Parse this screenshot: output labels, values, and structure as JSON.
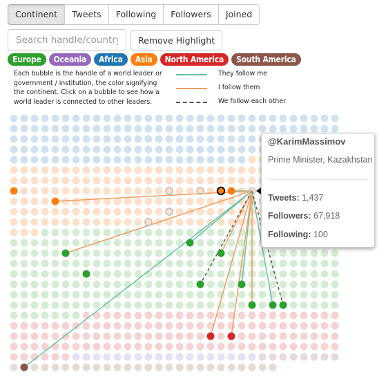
{
  "toolbar": {
    "sort_buttons": [
      {
        "label": "Continent",
        "active": true
      },
      {
        "label": "Tweets",
        "active": false
      },
      {
        "label": "Following",
        "active": false
      },
      {
        "label": "Followers",
        "active": false
      },
      {
        "label": "Joined",
        "active": false
      }
    ],
    "search": {
      "placeholder": "Search handle/country",
      "value": ""
    },
    "remove_highlight_label": "Remove Highlight"
  },
  "continents": [
    {
      "name": "Europe",
      "color": "#2ca02c",
      "light": "#d5ecd4"
    },
    {
      "name": "Oceania",
      "color": "#9467bd",
      "light": "#e8e0f3"
    },
    {
      "name": "Africa",
      "color": "#1f77b4",
      "light": "#d0e2ef"
    },
    {
      "name": "Asia",
      "color": "#ff7f0e",
      "light": "#fde0c9"
    },
    {
      "name": "North America",
      "color": "#d62728",
      "light": "#f5d3d3"
    },
    {
      "name": "South America",
      "color": "#8c564b",
      "light": "#e6dbd9"
    }
  ],
  "description": "Each bubble is the handle of a world leader or government / institution, the color signifying the continent. Click on a bubble to see how a world leader is connected to other leaders.",
  "legend": [
    {
      "label": "They follow me",
      "color": "#66c2a5",
      "style": "solid"
    },
    {
      "label": "I follow them",
      "color": "#f19d5e",
      "style": "solid"
    },
    {
      "label": "We follow each other",
      "color": "#555555",
      "style": "dashed"
    }
  ],
  "grid": {
    "columns": 32,
    "order": [
      {
        "continent": "Africa",
        "count": 151
      },
      {
        "continent": "Asia",
        "count": 204
      },
      {
        "continent": "Europe",
        "count": 260
      },
      {
        "continent": "North America",
        "count": 127
      },
      {
        "continent": "Oceania",
        "count": 18
      },
      {
        "continent": "South America",
        "count": 34
      }
    ]
  },
  "selected": {
    "handle": "@KarimMassimov",
    "title": "Prime Minister, Kazakhstan",
    "continent": "Asia",
    "stats": [
      {
        "label": "Tweets:",
        "value": "1,437"
      },
      {
        "label": "Followers:",
        "value": "67,918"
      },
      {
        "label": "Following:",
        "value": "100"
      }
    ]
  },
  "network": {
    "center": {
      "row": 7,
      "col": 23
    },
    "clicked": {
      "row": 7,
      "col": 20
    },
    "hollow": [
      {
        "row": 7,
        "col": 15
      },
      {
        "row": 7,
        "col": 18
      },
      {
        "row": 9,
        "col": 15
      },
      {
        "row": 10,
        "col": 13
      }
    ],
    "links": [
      {
        "row": 7,
        "col": 21,
        "type": "they",
        "continent": "Asia"
      },
      {
        "row": 7,
        "col": 0,
        "type": "none",
        "continent": "Asia"
      },
      {
        "row": 8,
        "col": 4,
        "type": "i",
        "continent": "Asia"
      },
      {
        "row": 13,
        "col": 5,
        "type": "i",
        "continent": "Europe"
      },
      {
        "row": 12,
        "col": 17,
        "type": "they",
        "continent": "Europe"
      },
      {
        "row": 13,
        "col": 20,
        "type": "i",
        "continent": "Europe"
      },
      {
        "row": 15,
        "col": 7,
        "type": "none",
        "continent": "Europe"
      },
      {
        "row": 16,
        "col": 18,
        "type": "mutual",
        "continent": "Europe"
      },
      {
        "row": 16,
        "col": 22,
        "type": "they",
        "continent": "Europe"
      },
      {
        "row": 18,
        "col": 23,
        "type": "i",
        "continent": "Europe"
      },
      {
        "row": 18,
        "col": 25,
        "type": "they",
        "continent": "Europe"
      },
      {
        "row": 18,
        "col": 26,
        "type": "mutual",
        "continent": "Europe"
      },
      {
        "row": 21,
        "col": 19,
        "type": "i",
        "continent": "North America"
      },
      {
        "row": 21,
        "col": 21,
        "type": "i",
        "continent": "North America"
      },
      {
        "row": 24,
        "col": 1,
        "type": "they",
        "continent": "South America"
      }
    ]
  }
}
